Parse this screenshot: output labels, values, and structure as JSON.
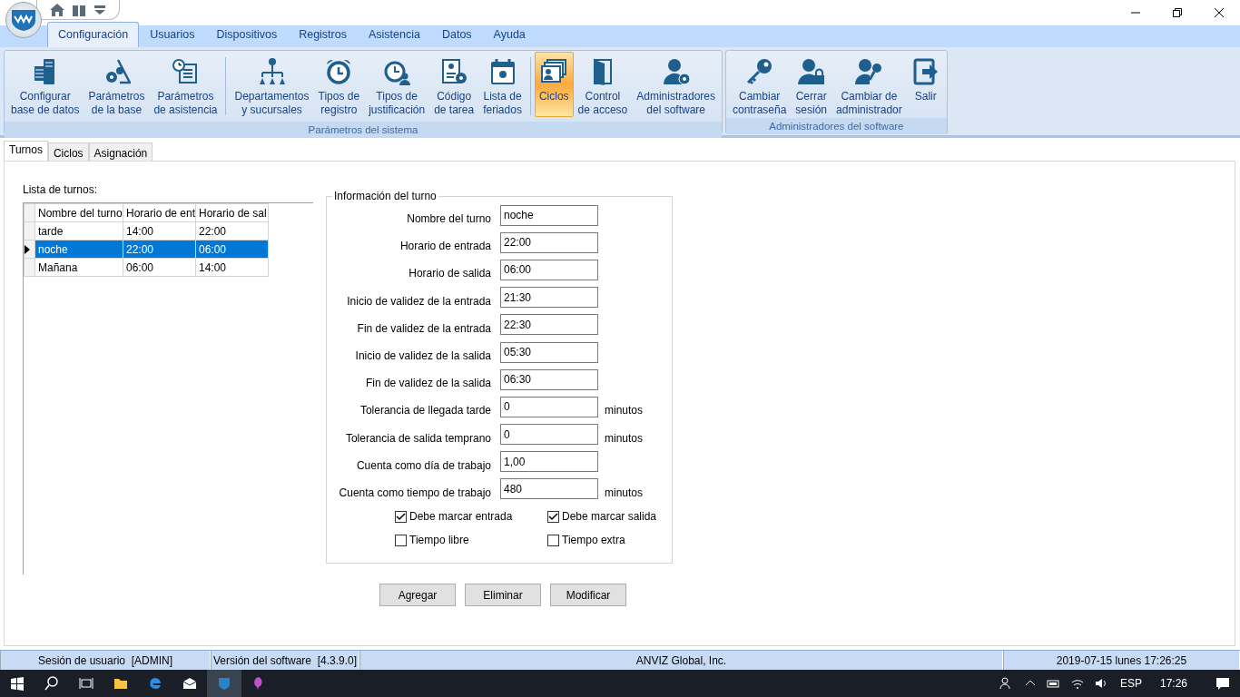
{
  "ribbon_tabs": [
    {
      "label": "Configuración",
      "selected": true
    },
    {
      "label": "Usuarios",
      "selected": false
    },
    {
      "label": "Dispositivos",
      "selected": false
    },
    {
      "label": "Registros",
      "selected": false
    },
    {
      "label": "Asistencia",
      "selected": false
    },
    {
      "label": "Datos",
      "selected": false
    },
    {
      "label": "Ayuda",
      "selected": false
    }
  ],
  "ribbon_groups": [
    {
      "title": "Parámetros del sistema",
      "buttons": [
        {
          "lines": [
            "Configurar",
            "base de datos"
          ],
          "selected": false
        },
        {
          "lines": [
            "Parámetros",
            "de la base"
          ],
          "selected": false
        },
        {
          "lines": [
            "Parámetros",
            "de asistencia"
          ],
          "selected": false
        },
        {
          "lines": [
            "Departamentos",
            "y sucursales"
          ],
          "selected": false
        },
        {
          "lines": [
            "Tipos de",
            "registro"
          ],
          "selected": false
        },
        {
          "lines": [
            "Tipos de",
            "justificación"
          ],
          "selected": false
        },
        {
          "lines": [
            "Código",
            "de tarea"
          ],
          "selected": false
        },
        {
          "lines": [
            "Lista de",
            "feriados"
          ],
          "selected": false
        },
        {
          "lines": [
            "Ciclos"
          ],
          "selected": true
        },
        {
          "lines": [
            "Control",
            "de acceso"
          ],
          "selected": false
        },
        {
          "lines": [
            "Administradores",
            "del software"
          ],
          "selected": false
        }
      ]
    },
    {
      "title": "Administradores del software",
      "buttons": [
        {
          "lines": [
            "Cambiar",
            "contraseña"
          ],
          "selected": false
        },
        {
          "lines": [
            "Cerrar",
            "sesión"
          ],
          "selected": false
        },
        {
          "lines": [
            "Cambiar de",
            "administrador"
          ],
          "selected": false
        },
        {
          "lines": [
            "Salir"
          ],
          "selected": false
        }
      ]
    }
  ],
  "page_tabs": [
    {
      "label": "Turnos",
      "selected": true
    },
    {
      "label": "Ciclos",
      "selected": false
    },
    {
      "label": "Asignación",
      "selected": false
    }
  ],
  "shift_list": {
    "label": "Lista de turnos:",
    "columns": [
      "Nombre del turno",
      "Horario de ent",
      "Horario de sal"
    ],
    "rows": [
      {
        "cells": [
          "tarde",
          "14:00",
          "22:00"
        ],
        "selected": false
      },
      {
        "cells": [
          "noche",
          "22:00",
          "06:00"
        ],
        "selected": true
      },
      {
        "cells": [
          "Mañana",
          "06:00",
          "14:00"
        ],
        "selected": false
      }
    ]
  },
  "shift_info": {
    "legend": "Información del turno",
    "fields": [
      {
        "label": "Nombre del turno",
        "value": "noche"
      },
      {
        "label": "Horario de entrada",
        "value": "22:00"
      },
      {
        "label": "Horario de salida",
        "value": "06:00"
      },
      {
        "label": "Inicio de validez de la entrada",
        "value": "21:30"
      },
      {
        "label": "Fin de validez de la entrada",
        "value": "22:30"
      },
      {
        "label": "Inicio de validez de la salida",
        "value": "05:30"
      },
      {
        "label": "Fin de validez de la salida",
        "value": "06:30"
      },
      {
        "label": "Tolerancia de llegada tarde",
        "value": "0",
        "unit": "minutos"
      },
      {
        "label": "Tolerancia de salida temprano",
        "value": "0",
        "unit": "minutos"
      },
      {
        "label": "Cuenta como día de trabajo",
        "value": "1,00"
      },
      {
        "label": "Cuenta como tiempo de trabajo",
        "value": "480",
        "unit": "minutos"
      }
    ],
    "checkboxes": [
      {
        "label": "Debe marcar entrada",
        "checked": true
      },
      {
        "label": "Debe marcar salida",
        "checked": true
      },
      {
        "label": "Tiempo libre",
        "checked": false
      },
      {
        "label": "Tiempo extra",
        "checked": false
      }
    ]
  },
  "buttons": [
    "Agregar",
    "Eliminar",
    "Modificar"
  ],
  "status_bar": [
    "Sesión de usuario  [ADMIN]",
    "Versión del software  [4.3.9.0]",
    "ANVIZ Global, Inc.",
    "2019-07-15 lunes 17:26:25"
  ],
  "taskbar": {
    "language": "ESP",
    "time": "17:26"
  }
}
